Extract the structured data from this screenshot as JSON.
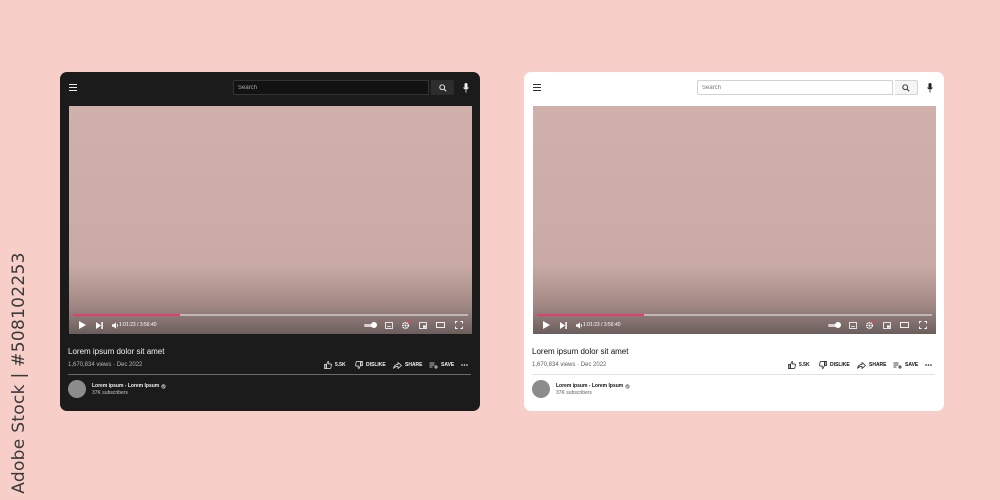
{
  "watermark": "Adobe Stock | #508102253",
  "players": [
    {
      "theme": "dark",
      "search": {
        "placeholder": "Search"
      },
      "video": {
        "progress_fraction": 0.27,
        "current_time": "1:01:23",
        "duration": "3:56:40",
        "time_display": "1:01:23 / 3:56:40"
      },
      "title": "Lorem ipsum dolor sit amet",
      "views": "1,670,834 views",
      "date": "Dec 2022",
      "meta": "1,670,834 views · Dec 2022",
      "actions": {
        "like_count": "5.5K",
        "dislike": "DISLIKE",
        "share": "SHARE",
        "save": "SAVE"
      },
      "channel": {
        "name": "Lorem ipsum - Lorem Ipsum",
        "subscribers": "37K subscribers"
      }
    },
    {
      "theme": "light",
      "search": {
        "placeholder": "Search"
      },
      "video": {
        "progress_fraction": 0.27,
        "current_time": "1:01:23",
        "duration": "3:56:40",
        "time_display": "1:01:23 / 3:56:40"
      },
      "title": "Lorem ipsum dolor sit amet",
      "views": "1,670,834 views",
      "date": "Dec 2022",
      "meta": "1,670,834 views · Dec 2022",
      "actions": {
        "like_count": "5.5K",
        "dislike": "DISLIKE",
        "share": "SHARE",
        "save": "SAVE"
      },
      "channel": {
        "name": "Lorem ipsum - Lorem Ipsum",
        "subscribers": "37K subscribers"
      }
    }
  ],
  "colors": {
    "page_background": "#f8cfc8",
    "progress_played": "#e0406a",
    "settings_badge": "#e0406a",
    "dark_panel": "#1b1b1b",
    "light_panel": "#ffffff"
  },
  "icons": [
    "menu-icon",
    "search-icon",
    "mic-icon",
    "play-icon",
    "next-icon",
    "volume-icon",
    "autoplay-toggle",
    "subtitles-icon",
    "settings-icon",
    "miniplayer-icon",
    "theater-icon",
    "fullscreen-icon",
    "like-icon",
    "dislike-icon",
    "share-icon",
    "save-icon",
    "more-icon",
    "verified-icon"
  ]
}
